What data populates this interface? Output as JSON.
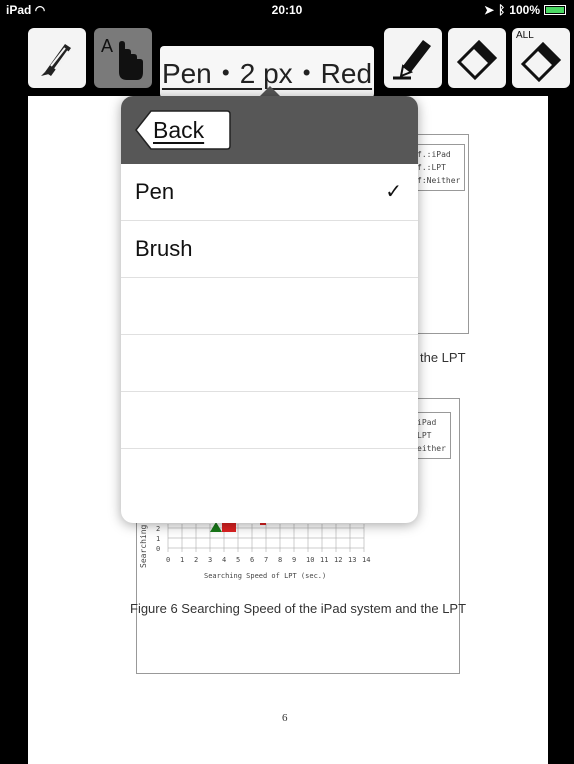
{
  "status_bar": {
    "device": "iPad",
    "time": "20:10",
    "battery": "100%"
  },
  "toolbar": {
    "pen_label": "Pen・2 px・Red",
    "clear_all_label": "ALL"
  },
  "popover": {
    "back_label": "Back",
    "items": [
      {
        "label": "Pen",
        "selected": true,
        "check": "✓"
      },
      {
        "label": "Brush",
        "selected": false,
        "check": ""
      }
    ]
  },
  "document": {
    "legend_top": [
      "f.:iPad",
      "f.:LPT",
      "f:Neither"
    ],
    "caption_fragment": "the LPT",
    "legend_bottom": [
      "iPad",
      "LPT",
      "either"
    ],
    "y_axis_label": "Searching",
    "x_ticks": [
      "0",
      "1",
      "2",
      "3",
      "4",
      "5",
      "6",
      "7",
      "8",
      "9",
      "10",
      "11",
      "12",
      "13",
      "14"
    ],
    "y_ticks": [
      "2",
      "1",
      "0"
    ],
    "x_axis_label": "Searching Speed of LPT (sec.)",
    "figure_caption": "Figure 6   Searching Speed of the iPad system and the LPT",
    "page_number": "6"
  },
  "colors": {
    "toolbar_bg": "#000000",
    "popover_header": "#575757",
    "battery": "#4cd964"
  }
}
